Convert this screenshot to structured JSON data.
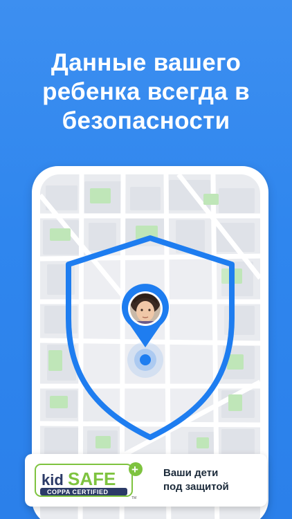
{
  "headline": {
    "line1": "Данные вашего",
    "line2": "ребенка всегда в",
    "line3": "безопасности"
  },
  "badge": {
    "logo_kid": "kid",
    "logo_safe": "SAFE",
    "logo_plus": "+",
    "logo_sub": "COPPA CERTIFIED",
    "logo_tm": "TM",
    "caption_line1": "Ваши дети",
    "caption_line2": "под защитой"
  },
  "colors": {
    "background": "#2f86ee",
    "accent": "#1e7df0",
    "map_bg": "#eceef1",
    "park": "#bfe6b8",
    "badge_green": "#7ec33f",
    "badge_navy": "#2b3a67"
  },
  "icons": {
    "shield": "shield-icon",
    "pin": "location-pin-icon",
    "avatar": "child-avatar"
  }
}
